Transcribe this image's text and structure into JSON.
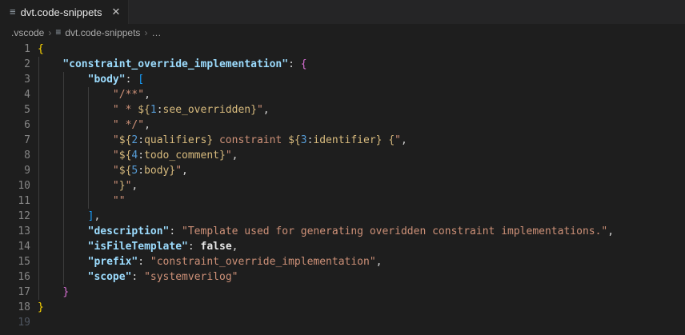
{
  "tab": {
    "title": "dvt.code-snippets",
    "file_icon": "≡",
    "close_glyph": "✕"
  },
  "breadcrumb": {
    "folder": ".vscode",
    "file": "dvt.code-snippets",
    "more": "…",
    "separator": "›",
    "file_icon": "≡"
  },
  "colors": {
    "editor_bg": "#1e1e1e",
    "tabbar_bg": "#252526",
    "key": "#9cdcfe",
    "string": "#ce9178",
    "placeholder": "#d7ba7d",
    "placeholder_num": "#569cd6",
    "bracket_l1": "#ffd700",
    "bracket_l2": "#da70d6",
    "bracket_l3": "#179fff",
    "line_number": "#858585"
  },
  "editor": {
    "lines": [
      {
        "n": "1",
        "dim": false,
        "tokens": [
          [
            "b1",
            "{"
          ]
        ]
      },
      {
        "n": "2",
        "dim": false,
        "tokens": [
          [
            "pn",
            "    "
          ],
          [
            "key",
            "\"constraint_override_implementation\""
          ],
          [
            "pn",
            ": "
          ],
          [
            "b2",
            "{"
          ]
        ]
      },
      {
        "n": "3",
        "dim": false,
        "tokens": [
          [
            "pn",
            "        "
          ],
          [
            "key",
            "\"body\""
          ],
          [
            "pn",
            ": "
          ],
          [
            "b3",
            "["
          ]
        ]
      },
      {
        "n": "4",
        "dim": false,
        "tokens": [
          [
            "pn",
            "            "
          ],
          [
            "str",
            "\"/**\""
          ],
          [
            "pn",
            ","
          ]
        ]
      },
      {
        "n": "5",
        "dim": false,
        "tokens": [
          [
            "pn",
            "            "
          ],
          [
            "str",
            "\" * "
          ],
          [
            "ph",
            "${"
          ],
          [
            "phn",
            "1"
          ],
          [
            "pn",
            ":"
          ],
          [
            "ph",
            "see_overridden"
          ],
          [
            "ph",
            "}"
          ],
          [
            "str",
            "\""
          ],
          [
            "pn",
            ","
          ]
        ]
      },
      {
        "n": "6",
        "dim": false,
        "tokens": [
          [
            "pn",
            "            "
          ],
          [
            "str",
            "\" */\""
          ],
          [
            "pn",
            ","
          ]
        ]
      },
      {
        "n": "7",
        "dim": false,
        "tokens": [
          [
            "pn",
            "            "
          ],
          [
            "str",
            "\""
          ],
          [
            "ph",
            "${"
          ],
          [
            "phn",
            "2"
          ],
          [
            "pn",
            ":"
          ],
          [
            "ph",
            "qualifiers}"
          ],
          [
            "str",
            " constraint "
          ],
          [
            "ph",
            "${"
          ],
          [
            "phn",
            "3"
          ],
          [
            "pn",
            ":"
          ],
          [
            "ph",
            "identifier}"
          ],
          [
            "str",
            " "
          ],
          [
            "ph",
            "{"
          ],
          [
            "str",
            "\""
          ],
          [
            "pn",
            ","
          ]
        ]
      },
      {
        "n": "8",
        "dim": false,
        "tokens": [
          [
            "pn",
            "            "
          ],
          [
            "str",
            "\""
          ],
          [
            "ph",
            "${"
          ],
          [
            "phn",
            "4"
          ],
          [
            "pn",
            ":"
          ],
          [
            "ph",
            "todo_comment}"
          ],
          [
            "str",
            "\""
          ],
          [
            "pn",
            ","
          ]
        ]
      },
      {
        "n": "9",
        "dim": false,
        "tokens": [
          [
            "pn",
            "            "
          ],
          [
            "str",
            "\""
          ],
          [
            "ph",
            "${"
          ],
          [
            "phn",
            "5"
          ],
          [
            "pn",
            ":"
          ],
          [
            "ph",
            "body}"
          ],
          [
            "str",
            "\""
          ],
          [
            "pn",
            ","
          ]
        ]
      },
      {
        "n": "10",
        "dim": false,
        "tokens": [
          [
            "pn",
            "            "
          ],
          [
            "str",
            "\""
          ],
          [
            "ph",
            "}"
          ],
          [
            "str",
            "\""
          ],
          [
            "pn",
            ","
          ]
        ]
      },
      {
        "n": "11",
        "dim": false,
        "tokens": [
          [
            "pn",
            "            "
          ],
          [
            "str",
            "\"\""
          ]
        ]
      },
      {
        "n": "12",
        "dim": false,
        "tokens": [
          [
            "pn",
            "        "
          ],
          [
            "b3",
            "]"
          ],
          [
            "pn",
            ","
          ]
        ]
      },
      {
        "n": "13",
        "dim": false,
        "tokens": [
          [
            "pn",
            "        "
          ],
          [
            "key",
            "\"description\""
          ],
          [
            "pn",
            ": "
          ],
          [
            "str",
            "\"Template used for generating overidden constraint implementations.\""
          ],
          [
            "pn",
            ","
          ]
        ]
      },
      {
        "n": "14",
        "dim": false,
        "tokens": [
          [
            "pn",
            "        "
          ],
          [
            "key",
            "\"isFileTemplate\""
          ],
          [
            "pn",
            ": "
          ],
          [
            "bool",
            "false"
          ],
          [
            "pn",
            ","
          ]
        ]
      },
      {
        "n": "15",
        "dim": false,
        "tokens": [
          [
            "pn",
            "        "
          ],
          [
            "key",
            "\"prefix\""
          ],
          [
            "pn",
            ": "
          ],
          [
            "str",
            "\"constraint_override_implementation\""
          ],
          [
            "pn",
            ","
          ]
        ]
      },
      {
        "n": "16",
        "dim": false,
        "tokens": [
          [
            "pn",
            "        "
          ],
          [
            "key",
            "\"scope\""
          ],
          [
            "pn",
            ": "
          ],
          [
            "str",
            "\"systemverilog\""
          ]
        ]
      },
      {
        "n": "17",
        "dim": false,
        "tokens": [
          [
            "pn",
            "    "
          ],
          [
            "b2",
            "}"
          ]
        ]
      },
      {
        "n": "18",
        "dim": false,
        "tokens": [
          [
            "b1",
            "}"
          ]
        ]
      },
      {
        "n": "19",
        "dim": true,
        "tokens": []
      }
    ]
  }
}
